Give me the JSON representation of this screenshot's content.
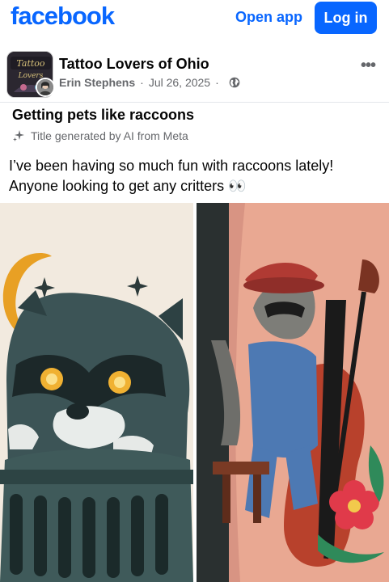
{
  "header": {
    "logo": "facebook",
    "open_app": "Open app",
    "login": "Log in"
  },
  "post": {
    "group_name": "Tattoo Lovers of Ohio",
    "author": "Erin Stephens",
    "date": "Jul 26, 2025",
    "separator": "·",
    "more": "•••",
    "title": "Getting pets like raccoons",
    "ai_note": "Title generated by AI from Meta",
    "text": "I’ve been having so much fun with raccoons lately! Anyone looking to get any critters 👀",
    "avatar_text": "Tattoo Lovers of Ohio"
  },
  "colors": {
    "brand": "#0866ff",
    "secondary_text": "#65676b"
  },
  "icons": {
    "globe": "globe-icon",
    "sparkle": "sparkle-icon",
    "more": "more-options-icon"
  },
  "photos": [
    {
      "alt": "raccoon-tattoo-moon"
    },
    {
      "alt": "raccoon-playing-bass-tattoo"
    }
  ]
}
